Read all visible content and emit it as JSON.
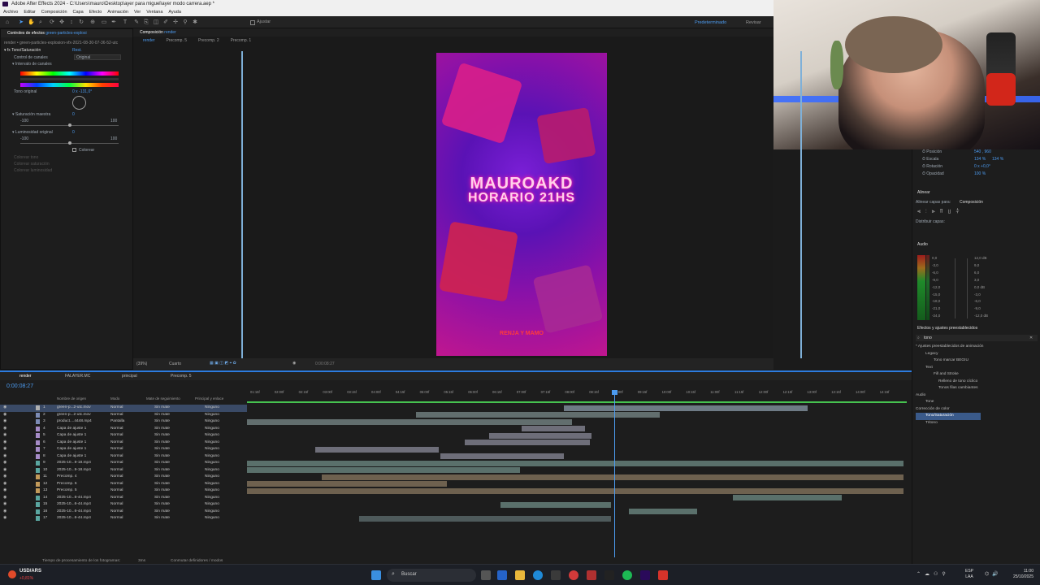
{
  "window": {
    "title": "Adobe After Effects 2024 - C:\\Users\\mauro\\Desktop\\ayer para miguel\\ayer modo carrera.aep *"
  },
  "menu": [
    "Archivo",
    "Editar",
    "Composición",
    "Capa",
    "Efecto",
    "Animación",
    "Ver",
    "Ventana",
    "Ayuda"
  ],
  "toolbar": {
    "snap_label": "Ajustar",
    "workspace": "Predeterminado",
    "review": "Revisar"
  },
  "effects_panel": {
    "tab": "Controles de efectos",
    "tab_target": "green-particles-explosi",
    "breadcrumb": "render • green-particles-explosion-vfx-2021-08-30-07-36-52-utc",
    "effect_name": "Tono/Saturación",
    "reset": "Rest.",
    "channel_control_label": "Control de canales",
    "channel_control_value": "Original",
    "channel_range_label": "Intervalo de canales",
    "hue_label": "Tono original",
    "hue_value": "0 x -131,0°",
    "sat_label": "Saturación maestra",
    "sat_value": "0",
    "sat_min": "-100",
    "sat_max": "100",
    "light_label": "Luminosidad original",
    "light_value": "0",
    "light_min": "-100",
    "light_max": "100",
    "colorize_label": "Colorear",
    "colorize_hue": "Colorear tono",
    "colorize_sat": "Colorear saturación",
    "colorize_light": "Colorear luminosidad"
  },
  "comp_panel": {
    "tab_label": "Composición",
    "tab_target": "render",
    "subtabs": [
      "render",
      "Precomp. 5",
      "Precomp. 2",
      "Precomp. 1"
    ],
    "zoom": "(39%)",
    "resolution": "Cuarto",
    "timecode": "0:00:08:27"
  },
  "poster": {
    "line1": "MAUROAKD",
    "line2": "HORARIO 21HS",
    "footer": "RENJA Y MAMO"
  },
  "transform": {
    "position": "Posición",
    "position_val": "540 , 960",
    "scale": "Escala",
    "scale_val": "134 %",
    "scale_val2": "134 %",
    "rotation": "Rotación",
    "rotation_val": "0 x +0,0°",
    "opacity": "Opacidad",
    "opacity_val": "100 %"
  },
  "align_panel": {
    "title": "Alinear",
    "align_to": "Alinear capas para:",
    "align_target": "Composición",
    "distribute": "Distribuir capas:"
  },
  "audio_panel": {
    "title": "Audio",
    "left_scale": [
      "0,0",
      "-3,0",
      "-6,0",
      "-9,0",
      "-12,0",
      "-15,0",
      "-18,0",
      "-21,0",
      "-24,0"
    ],
    "right_scale": [
      "12,0 dB",
      "9,0",
      "6,0",
      "3,0",
      "0,0 dB",
      "-3,0",
      "-6,0",
      "-9,0",
      "-12,0 dB"
    ]
  },
  "effects_presets": {
    "title": "Efectos y ajustes preestablecidos",
    "search": "tono",
    "tree": [
      "* Ajustes preestablecidos de animación",
      "Legacy",
      "Tono marcar BEGIU",
      "Text",
      "Fill and Stroke",
      "Relleno de tono cíclico",
      "Tonos filas cambiantes",
      "Audio",
      "Tone",
      "Corrección de color",
      "Tono/Saturación",
      "Tritono"
    ]
  },
  "timeline": {
    "tabs": [
      "render",
      "FALAYER.MC",
      "principal",
      "Precomp. 5"
    ],
    "timecode": "0:00:08:27",
    "col_name": "Nombre de origen",
    "col_mode": "Modo",
    "col_track": "Mate de seguimiento",
    "col_parent": "Principal y enlace",
    "ruler": [
      "01:15f",
      "02:00f",
      "02:15f",
      "03:00f",
      "03:15f",
      "04:00f",
      "04:15f",
      "05:00f",
      "05:15f",
      "06:00f",
      "06:15f",
      "07:00f",
      "07:15f",
      "08:00f",
      "08:15f",
      "09:00f",
      "09:15f",
      "10:00f",
      "10:15f",
      "11:00f",
      "11:15f",
      "12:00f",
      "12:15f",
      "13:00f",
      "13:15f",
      "14:00f",
      "14:15f"
    ],
    "layers": [
      {
        "n": "1",
        "name": "green-p...2-utc.mov",
        "mode": "Normal",
        "track": "Sin mate",
        "parent": "Ninguno"
      },
      {
        "n": "2",
        "name": "green-p...2-utc.mov",
        "mode": "Normal",
        "track": "Sin mate",
        "parent": "Ninguno"
      },
      {
        "n": "3",
        "name": "product....4448.mp4",
        "mode": "Pantalla",
        "track": "Sin mate",
        "parent": "Ninguno"
      },
      {
        "n": "4",
        "name": "Capa de ajuste 1",
        "mode": "Normal",
        "track": "Sin mate",
        "parent": "Ninguno"
      },
      {
        "n": "5",
        "name": "Capa de ajuste 1",
        "mode": "Normal",
        "track": "Sin mate",
        "parent": "Ninguno"
      },
      {
        "n": "6",
        "name": "Capa de ajuste 1",
        "mode": "Normal",
        "track": "Sin mate",
        "parent": "Ninguno"
      },
      {
        "n": "7",
        "name": "Capa de ajuste 1",
        "mode": "Normal",
        "track": "Sin mate",
        "parent": "Ninguno"
      },
      {
        "n": "8",
        "name": "Capa de ajuste 1",
        "mode": "Normal",
        "track": "Sin mate",
        "parent": "Ninguno"
      },
      {
        "n": "9",
        "name": "2025-10...9-18.mp4",
        "mode": "Normal",
        "track": "Sin mate",
        "parent": "Ninguno"
      },
      {
        "n": "10",
        "name": "2025-10...9-18.mp4",
        "mode": "Normal",
        "track": "Sin mate",
        "parent": "Ninguno"
      },
      {
        "n": "11",
        "name": "Precomp. 4",
        "mode": "Normal",
        "track": "Sin mate",
        "parent": "Ninguno"
      },
      {
        "n": "12",
        "name": "Precomp. 6",
        "mode": "Normal",
        "track": "Sin mate",
        "parent": "Ninguno"
      },
      {
        "n": "13",
        "name": "Precomp. 5",
        "mode": "Normal",
        "track": "Sin mate",
        "parent": "Ninguno"
      },
      {
        "n": "14",
        "name": "2025-10...6-44.mp4",
        "mode": "Normal",
        "track": "Sin mate",
        "parent": "Ninguno"
      },
      {
        "n": "15",
        "name": "2025-10...6-44.mp4",
        "mode": "Normal",
        "track": "Sin mate",
        "parent": "Ninguno"
      },
      {
        "n": "16",
        "name": "2025-10...6-44.mp4",
        "mode": "Normal",
        "track": "Sin mate",
        "parent": "Ninguno"
      },
      {
        "n": "17",
        "name": "2025-10...6-44.mp4",
        "mode": "Normal",
        "track": "Sin mate",
        "parent": "Ninguno"
      }
    ],
    "footer_left": "Tiempo de procesamiento de los fotogramas:",
    "footer_time": "3ms",
    "footer_mid": "Conmutar definidores / modos"
  },
  "taskbar": {
    "ticker": "USD/ARS",
    "ticker_change": "+0,81%",
    "search": "Buscar",
    "lang": "ESP",
    "lang2": "LAA",
    "time": "11:00",
    "date": "25/10/2025"
  }
}
